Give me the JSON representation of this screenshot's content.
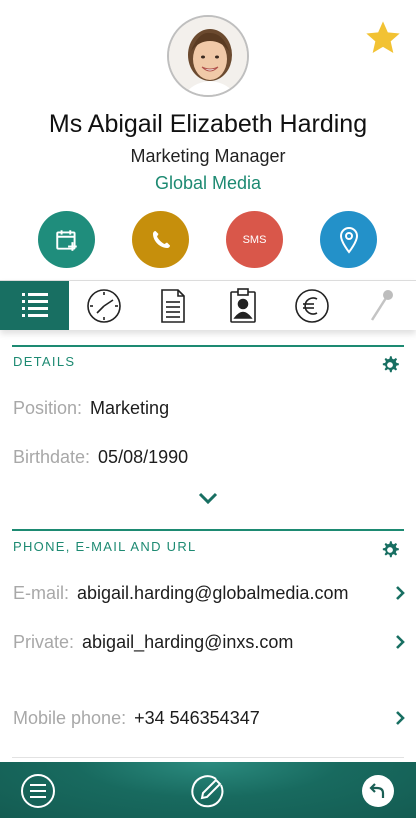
{
  "contact": {
    "full_name": "Ms Abigail Elizabeth Harding",
    "job_title": "Marketing Manager",
    "company": "Global Media",
    "favorite": true
  },
  "actions": [
    {
      "name": "calendar-add",
      "icon": "calendar-plus-icon"
    },
    {
      "name": "call",
      "icon": "phone-icon"
    },
    {
      "name": "sms",
      "label": "SMS"
    },
    {
      "name": "location",
      "icon": "location-pin-icon"
    }
  ],
  "tabs": [
    {
      "name": "details",
      "icon": "list-icon",
      "active": true
    },
    {
      "name": "history",
      "icon": "clock-icon"
    },
    {
      "name": "documents",
      "icon": "document-icon"
    },
    {
      "name": "card",
      "icon": "id-badge-icon"
    },
    {
      "name": "finance",
      "icon": "euro-icon"
    },
    {
      "name": "pin",
      "icon": "pin-icon"
    }
  ],
  "details": {
    "title": "DETAILS",
    "position_label": "Position:",
    "position_value": "Marketing",
    "birthdate_label": "Birthdate:",
    "birthdate_value": "05/08/1990"
  },
  "contact_info": {
    "title": "PHONE, E-MAIL AND URL",
    "email_label": "E-mail:",
    "email_value": "abigail.harding@globalmedia.com",
    "private_label": "Private:",
    "private_value": "abigail_harding@inxs.com",
    "mobile_label": "Mobile phone:",
    "mobile_value": "+34 546354347"
  },
  "colors": {
    "accent": "#1d8a72",
    "calendar": "#1f8d7c",
    "call": "#c68f0c",
    "sms": "#d9574a",
    "location": "#2391c9",
    "star": "#f2c233",
    "bottom_bar": "#186a5f"
  },
  "bottom_bar": [
    {
      "name": "menu",
      "icon": "menu-icon"
    },
    {
      "name": "edit",
      "icon": "edit-icon"
    },
    {
      "name": "back",
      "icon": "undo-icon"
    }
  ]
}
